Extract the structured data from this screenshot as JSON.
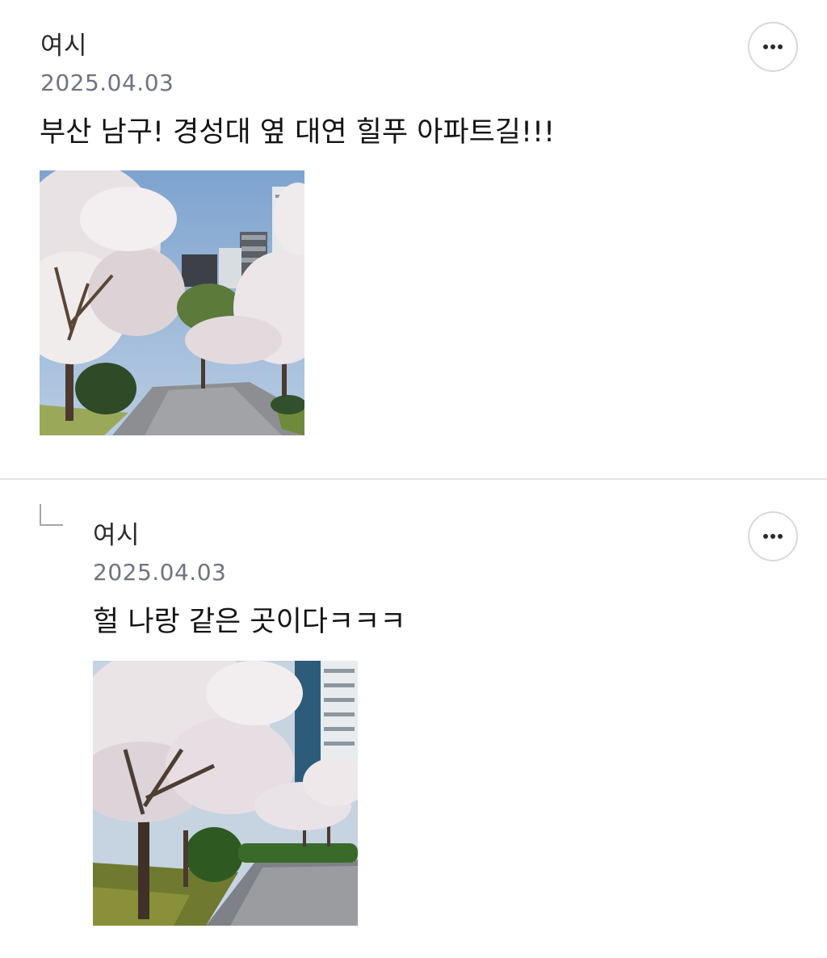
{
  "comments": [
    {
      "author": "여시",
      "date": "2025.04.03",
      "text": "부산 남구! 경성대 옆 대연 힐푸 아파트길!!!",
      "image_icon": "photo-icon",
      "more_icon": "more-horizontal-icon"
    },
    {
      "author": "여시",
      "date": "2025.04.03",
      "text": "헐 나랑 같은 곳이다ㅋㅋㅋ",
      "is_reply": true,
      "reply_icon": "reply-arrow-icon",
      "image_icon": "photo-icon",
      "more_icon": "more-horizontal-icon"
    }
  ],
  "colors": {
    "author": "#2b2b2b",
    "date": "#6f7382",
    "text": "#141414",
    "divider": "#e4e4e6",
    "button_border": "#d9d9dc"
  }
}
